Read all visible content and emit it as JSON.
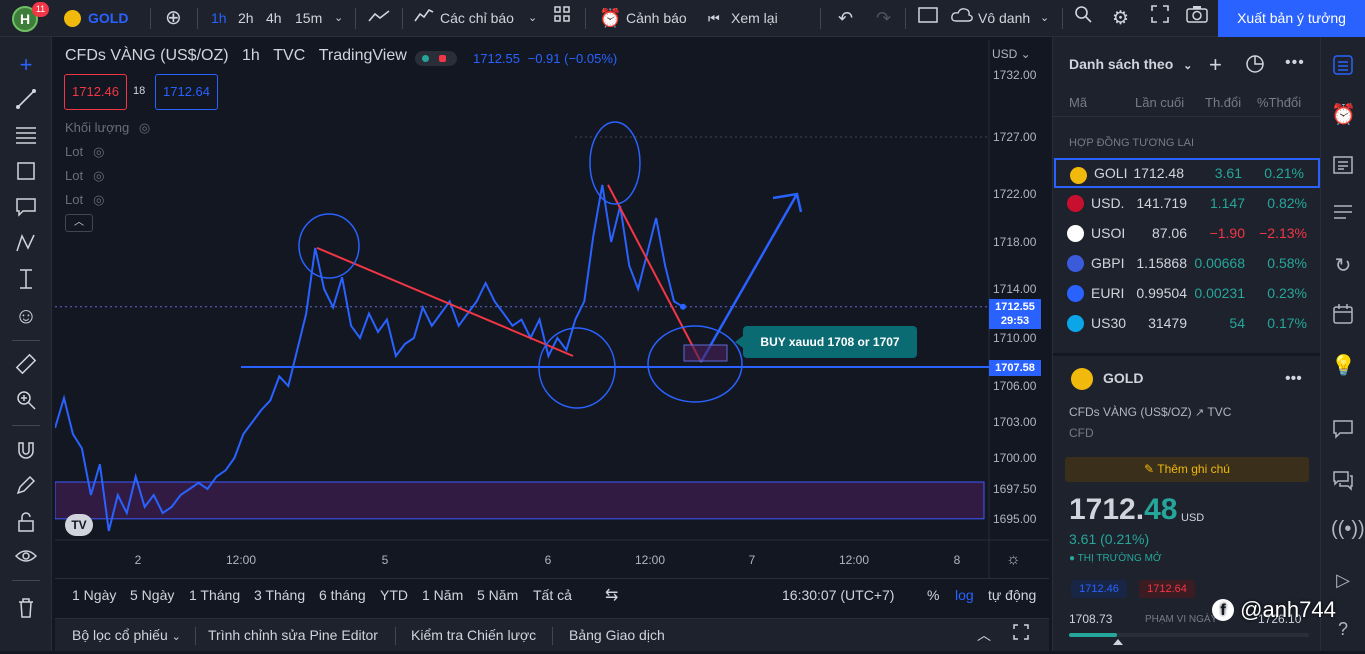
{
  "topbar": {
    "avatar_letter": "H",
    "notif_count": "11",
    "symbol": "GOLD",
    "intervals": [
      "1h",
      "2h",
      "4h",
      "15m"
    ],
    "indicators_label": "Các chỉ báo",
    "alerts_label": "Cảnh báo",
    "replay_label": "Xem lại",
    "layout_label": "Vô danh",
    "publish_label": "Xuất bản ý tưởng"
  },
  "chart": {
    "title": "CFDs VÀNG (US$/OZ)",
    "interval": "1h",
    "source": "TVC",
    "provider": "TradingView",
    "last_price": "1712.55",
    "change": "−0.91 (−0.05%)",
    "sell_price": "1712.46",
    "spread": "18",
    "buy_price": "1712.64",
    "volume_label": "Khối lượng",
    "lot_labels": [
      "Lot",
      "Lot",
      "Lot"
    ],
    "currency": "USD",
    "price_label": "1712.55",
    "countdown": "29:53",
    "hline_label": "1707.58",
    "annotation": "BUY xauud 1708 or 1707",
    "logo": "TV"
  },
  "chart_data": {
    "type": "line",
    "title": "CFDs VÀNG (US$/OZ)",
    "y_ticks": [
      "1732.00",
      "1727.00",
      "1722.00",
      "1718.00",
      "1714.00",
      "1710.00",
      "1706.00",
      "1703.00",
      "1700.00",
      "1697.50",
      "1695.00"
    ],
    "x_ticks": [
      "2",
      "12:00",
      "5",
      "6",
      "12:00",
      "7",
      "12:00",
      "8"
    ],
    "ylim": [
      1694,
      1733
    ],
    "horizontal_lines": [
      1707.58,
      1712.55
    ],
    "series": [
      {
        "values": [
          1702.5,
          1705.0,
          1702.0,
          1700.8,
          1697.0,
          1699.5,
          1694.0,
          1697.0,
          1695.5,
          1698.5,
          1696.0,
          1697.0,
          1695.5,
          1696.0,
          1697.0,
          1697.5,
          1698.0,
          1697.5,
          1698.5,
          1699.0,
          1700.0,
          1702.0,
          1703.0,
          1704.0,
          1704.8,
          1706.8,
          1706.0,
          1709.0,
          1712.0,
          1717.5,
          1714.0,
          1712.5,
          1715.0,
          1711.0,
          1710.0,
          1712.0,
          1710.5,
          1711.5,
          1708.5,
          1709.5,
          1710.0,
          1712.5,
          1711.0,
          1712.0,
          1713.0,
          1711.0,
          1712.0,
          1713.0,
          1714.5,
          1713.0,
          1712.0,
          1711.0,
          1711.5,
          1710.0,
          1711.5,
          1708.5,
          1710.0,
          1709.0,
          1711.5,
          1713.0,
          1718.5,
          1722.8,
          1718.0,
          1721.0,
          1716.0,
          1714.0,
          1717.0,
          1720.0,
          1716.0,
          1713.0,
          1712.55
        ]
      }
    ]
  },
  "bottombar": {
    "ranges": [
      "1 Ngày",
      "5 Ngày",
      "1 Tháng",
      "3 Tháng",
      "6 tháng",
      "YTD",
      "1 Năm",
      "5 Năm",
      "Tất cả"
    ],
    "time": "16:30:07 (UTC+7)",
    "percent": "%",
    "log": "log",
    "auto": "tự động"
  },
  "footer": {
    "tabs": [
      "Bộ lọc cổ phiếu",
      "Trình chỉnh sửa Pine Editor",
      "Kiểm tra Chiến lược",
      "Bảng Giao dịch"
    ]
  },
  "watchlist": {
    "title": "Danh sách theo",
    "col_symbol": "Mã",
    "col_last": "Lần cuối",
    "col_change": "Th.đổi",
    "col_pct": "%Thđổi",
    "section": "HỢP ĐỒNG TƯƠNG LAI",
    "rows": [
      {
        "symbol": "GOLI",
        "last": "1712.48",
        "change": "3.61",
        "pct": "0.21%",
        "dir": "up",
        "icon": "G",
        "color": "#f0b90b"
      },
      {
        "symbol": "USD.",
        "last": "141.719",
        "change": "1.147",
        "pct": "0.82%",
        "dir": "up",
        "icon": "US",
        "color": "#c8102e"
      },
      {
        "symbol": "USOI",
        "last": "87.06",
        "change": "−1.90",
        "pct": "−2.13%",
        "dir": "down",
        "icon": "oil",
        "color": "#ffffff"
      },
      {
        "symbol": "GBPI",
        "last": "1.15868",
        "change": "0.00668",
        "pct": "0.58%",
        "dir": "up",
        "icon": "GB",
        "color": "#3b5bdb"
      },
      {
        "symbol": "EURI",
        "last": "0.99504",
        "change": "0.00231",
        "pct": "0.23%",
        "dir": "up",
        "icon": "EU",
        "color": "#2962ff"
      },
      {
        "symbol": "US30",
        "last": "31479",
        "change": "54",
        "pct": "0.17%",
        "dir": "up",
        "icon": "30",
        "color": "#0aa6e8"
      }
    ]
  },
  "details": {
    "symbol": "GOLD",
    "name": "CFDs VÀNG (US$/OZ)",
    "exchange": "TVC",
    "type": "CFD",
    "note_button": "Thêm ghi chú",
    "price_main": "1712.",
    "price_frac": "48",
    "currency": "USD",
    "change": "3.61 (0.21%)",
    "market_status": "THỊ TRƯỜNG MỞ",
    "bid": "1712.46",
    "ask": "1712.64",
    "low": "1708.73",
    "range_label": "PHẠM VI NGÀY",
    "high": "1726.10",
    "range_fill": 0.2
  },
  "watermark": "@anh744",
  "colors": {
    "accent": "#2962ff",
    "up": "#26a69a",
    "down": "#f23645",
    "drawing_red": "#f23645",
    "line": "#2962ff"
  }
}
